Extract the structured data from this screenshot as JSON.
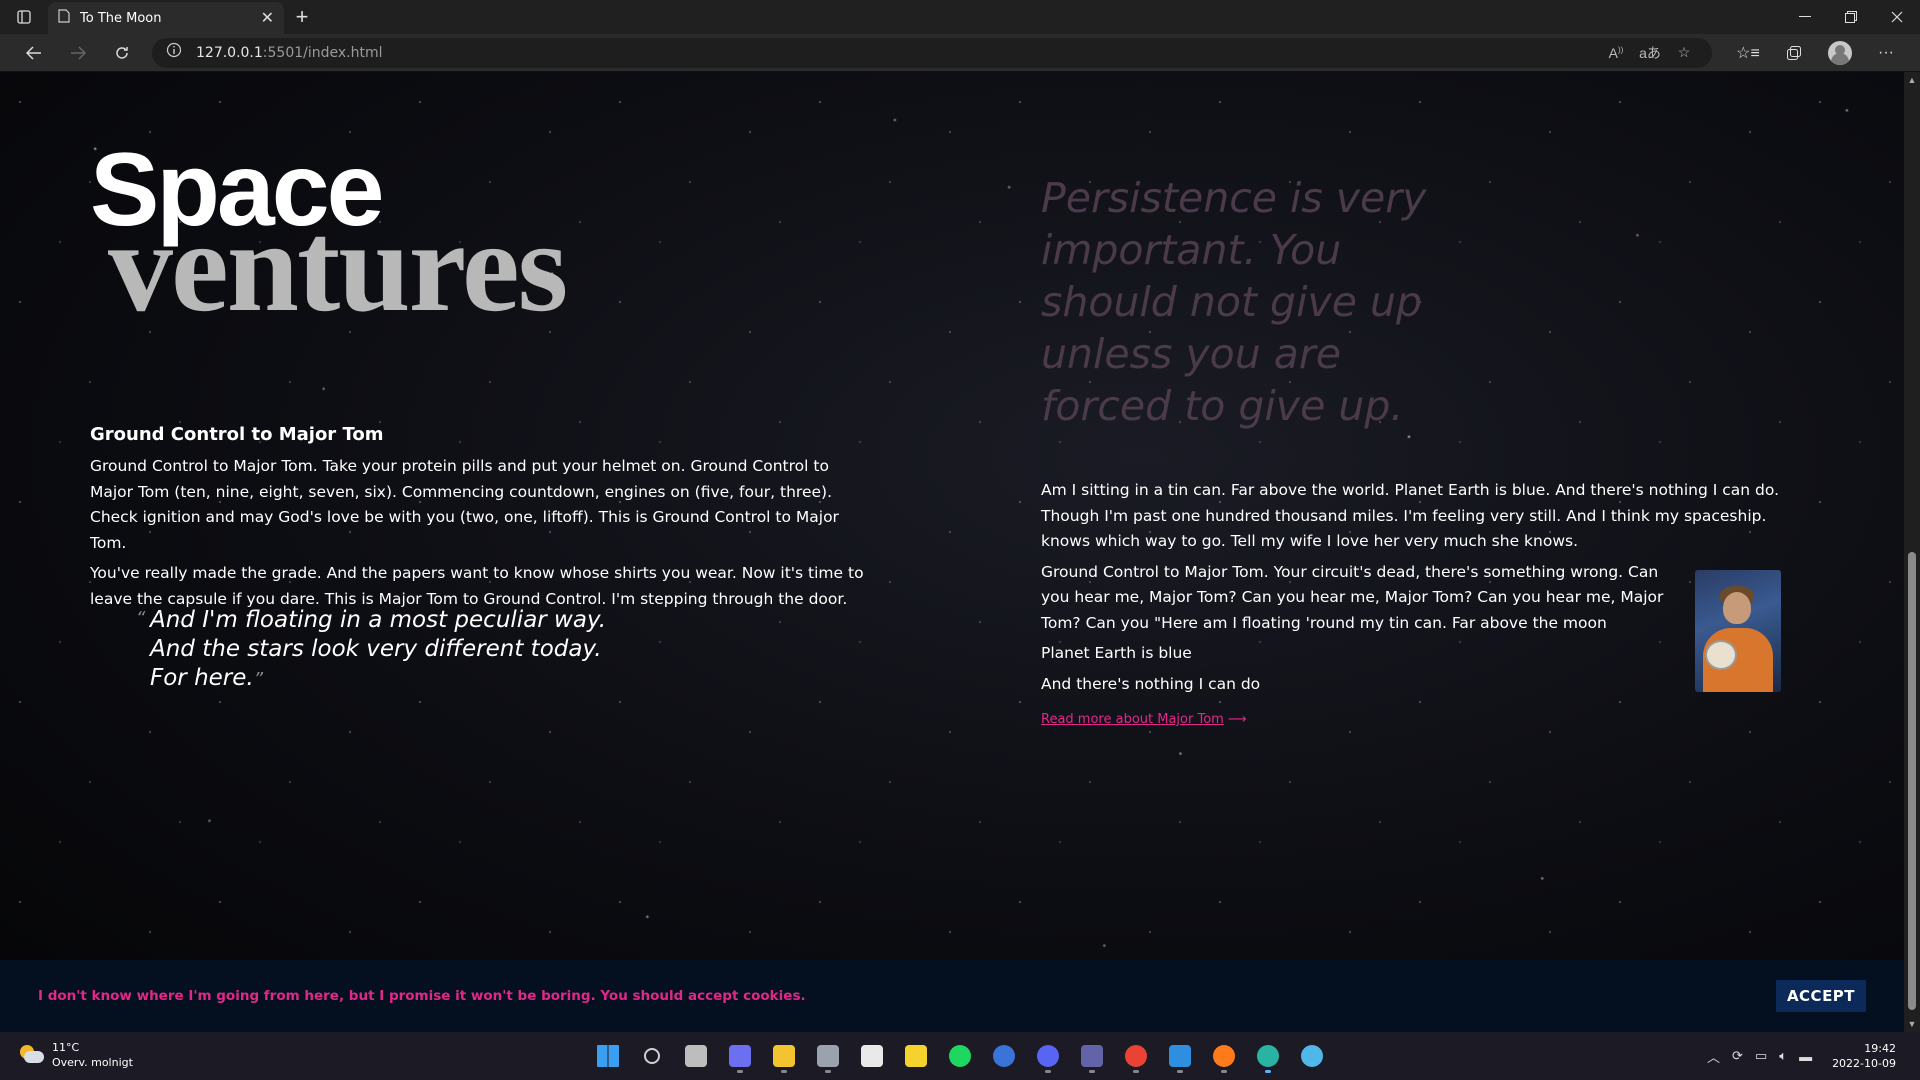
{
  "browser": {
    "tab_title": "To The Moon",
    "url_host": "127.0.0.1",
    "url_rest": ":5501/index.html",
    "new_tab_glyph": "+",
    "close_glyph": "✕"
  },
  "page": {
    "brand_top": "Space",
    "brand_bottom": "ventures",
    "left_heading": "Ground Control to Major Tom",
    "left_p1": "Ground Control to Major Tom. Take your protein pills and put your helmet on. Ground Control to Major Tom (ten, nine, eight, seven, six). Commencing countdown, engines on (five, four, three). Check ignition and may God's love be with you (two, one, liftoff). This is Ground Control to Major Tom.",
    "left_p2": "You've really made the grade. And the papers want to know whose shirts you wear. Now it's time to leave the capsule if you dare. This is Major Tom to Ground Control. I'm stepping through the door.",
    "quote_line1": "And I'm floating in a most peculiar way.",
    "quote_line2": "And the stars look very different today.",
    "quote_line3": "For here.",
    "quote_open": "“",
    "quote_close": "”",
    "persistence": "Persistence is very important. You should not give up unless you are forced to give up.",
    "right_p1": "Am I sitting in a tin can. Far above the world. Planet Earth is blue. And there's nothing I can do. Though I'm past one hundred thousand miles. I'm feeling very still. And I think my spaceship. knows which way to go. Tell my wife I love her very much she knows.",
    "right_p2": "Ground Control to Major Tom. Your circuit's dead, there's something wrong. Can you hear me, Major Tom? Can you hear me, Major Tom? Can you hear me, Major Tom? Can you \"Here am I floating 'round my tin can. Far above the moon",
    "right_p3": "Planet Earth is blue",
    "right_p4": "And there's nothing I can do",
    "read_more": "Read more about Major Tom",
    "read_more_arrow": "⟶"
  },
  "cookie": {
    "text": "I don't know where I'm going from here, but I promise it won't be boring. You should accept cookies.",
    "accept": "ACCEPT"
  },
  "taskbar": {
    "temp": "11°C",
    "weather": "Overv. molnigt",
    "time": "19:42",
    "date": "2022-10-09",
    "apps": [
      {
        "name": "start",
        "color": "#3a9ff0"
      },
      {
        "name": "search",
        "color": "#d0d0d0"
      },
      {
        "name": "task-view",
        "color": "#bdbdbd"
      },
      {
        "name": "chat",
        "color": "#6b6ff0"
      },
      {
        "name": "file-explorer",
        "color": "#f4c430"
      },
      {
        "name": "settings",
        "color": "#9aa3ad"
      },
      {
        "name": "store",
        "color": "#e9e9e9"
      },
      {
        "name": "sticky-notes",
        "color": "#f6d22c"
      },
      {
        "name": "spotify",
        "color": "#1ed760"
      },
      {
        "name": "app-blue",
        "color": "#3a74d8"
      },
      {
        "name": "discord",
        "color": "#5865f2"
      },
      {
        "name": "teams",
        "color": "#6264a7"
      },
      {
        "name": "chrome",
        "color": "#e94335"
      },
      {
        "name": "vscode",
        "color": "#2f8ee0"
      },
      {
        "name": "firefox",
        "color": "#ff7a1a"
      },
      {
        "name": "edge",
        "color": "#28b3a2"
      },
      {
        "name": "paint",
        "color": "#4fb8e8"
      }
    ]
  },
  "colors": {
    "accent": "#e0288a",
    "cookie_bg": "#04101f",
    "button_bg": "#0b2a5a",
    "persistence_text": "#4a3a4a"
  }
}
